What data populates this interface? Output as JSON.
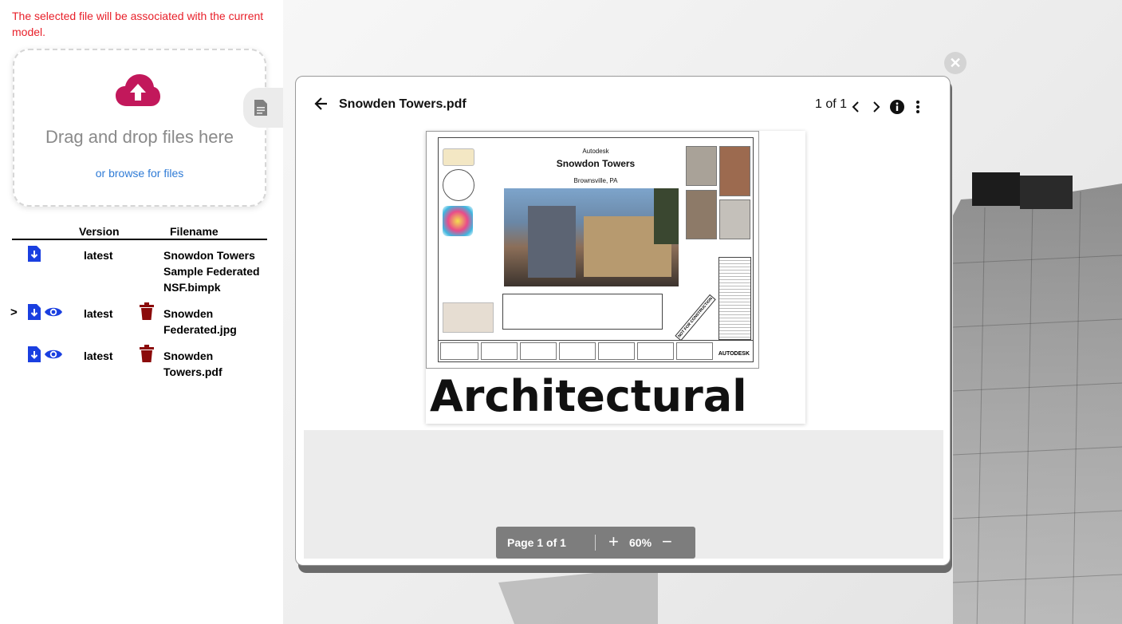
{
  "sidebar": {
    "notice": "The selected file will be associated with the current model.",
    "dropzone": {
      "icon": "cloud-upload-icon",
      "icon_color": "#c2185b",
      "text": "Drag and drop files here",
      "browse_label": "or browse for files"
    },
    "doc_tab_icon": "document-icon",
    "table": {
      "headers": {
        "version": "Version",
        "filename": "Filename"
      },
      "rows": [
        {
          "expand": "",
          "version": "latest",
          "filename_line1": "Snowdon Towers",
          "filename_line2": "Sample Federated",
          "filename_line3": "NSF.bimpk",
          "icons": [
            "download-icon"
          ]
        },
        {
          "expand": ">",
          "version": "latest",
          "filename_line1": "Snowden",
          "filename_line2": "Federated.jpg",
          "icons": [
            "download-icon",
            "view-icon",
            "delete-icon"
          ]
        },
        {
          "expand": "",
          "version": "latest",
          "filename_line1": "Snowden",
          "filename_line2": "Towers.pdf",
          "icons": [
            "download-icon",
            "view-icon",
            "delete-icon"
          ]
        }
      ]
    }
  },
  "viewer": {
    "title": "Snowden Towers.pdf",
    "page_count": "1 of 1",
    "document": {
      "company": "Autodesk",
      "project": "Snowdon Towers",
      "location": "Brownsville, PA",
      "brand": "AUTODESK",
      "stamp": "NOT FOR CONSTRUCTION",
      "caption": "Architectural"
    },
    "page_bar": {
      "page_label": "Page 1 of 1",
      "zoom": "60%"
    }
  },
  "colors": {
    "download": "#1a3fe0",
    "delete": "#8b0a0a",
    "notice": "#e8202a",
    "link": "#2f7bd6"
  }
}
